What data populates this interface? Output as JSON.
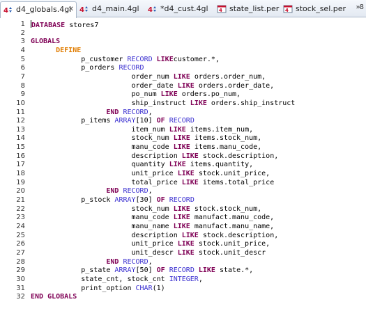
{
  "tabs": [
    {
      "label": "d4_globals.4gl",
      "active": true,
      "icon": "4gl-file-icon",
      "close": "✕"
    },
    {
      "label": "d4_main.4gl",
      "active": false,
      "icon": "4gl-file-icon"
    },
    {
      "label": "*d4_cust.4gl",
      "active": false,
      "icon": "4gl-file-icon"
    },
    {
      "label": "state_list.per",
      "active": false,
      "icon": "form-file-icon"
    },
    {
      "label": "stock_sel.per",
      "active": false,
      "icon": "form-file-icon"
    }
  ],
  "overflow_label": "»8",
  "lines": [
    {
      "n": "1",
      "tokens": [
        [
          "kw",
          "DATABASE"
        ],
        [
          "",
          "stores7"
        ]
      ]
    },
    {
      "n": "2",
      "tokens": []
    },
    {
      "n": "3",
      "tokens": [
        [
          "kw",
          "GLOBALS"
        ]
      ]
    },
    {
      "n": "4",
      "tokens": [
        [
          "",
          "      "
        ],
        [
          "kw2",
          "DEFINE"
        ]
      ]
    },
    {
      "n": "5",
      "tokens": [
        [
          "",
          "            p_customer "
        ],
        [
          "ty",
          "RECORD"
        ],
        [
          "",
          ""
        ],
        [
          "kw",
          " LIKE"
        ],
        [
          "",
          ""
        ],
        [
          "",
          "customer.*,"
        ]
      ]
    },
    {
      "n": "6",
      "tokens": [
        [
          "",
          "            p_orders "
        ],
        [
          "ty",
          "RECORD"
        ]
      ]
    },
    {
      "n": "7",
      "tokens": [
        [
          "",
          "                        order_num "
        ],
        [
          "kw",
          "LIKE"
        ],
        [
          "",
          " orders.order_num,"
        ]
      ]
    },
    {
      "n": "8",
      "tokens": [
        [
          "",
          "                        order_date "
        ],
        [
          "kw",
          "LIKE"
        ],
        [
          "",
          " orders.order_date,"
        ]
      ]
    },
    {
      "n": "9",
      "tokens": [
        [
          "",
          "                        po_num "
        ],
        [
          "kw",
          "LIKE"
        ],
        [
          "",
          " orders.po_num,"
        ]
      ]
    },
    {
      "n": "10",
      "tokens": [
        [
          "",
          "                        ship_instruct "
        ],
        [
          "kw",
          "LIKE"
        ],
        [
          "",
          " orders.ship_instruct"
        ]
      ]
    },
    {
      "n": "11",
      "tokens": [
        [
          "",
          "                  "
        ],
        [
          "kw",
          "END"
        ],
        [
          "",
          " "
        ],
        [
          "ty",
          "RECORD"
        ],
        [
          "",
          ","
        ]
      ]
    },
    {
      "n": "12",
      "tokens": [
        [
          "",
          "            p_items "
        ],
        [
          "ty",
          "ARRAY"
        ],
        [
          "",
          "[10] "
        ],
        [
          "kw",
          "OF"
        ],
        [
          "",
          " "
        ],
        [
          "ty",
          "RECORD"
        ]
      ]
    },
    {
      "n": "13",
      "tokens": [
        [
          "",
          "                        item_num "
        ],
        [
          "kw",
          "LIKE"
        ],
        [
          "",
          " items.item_num,"
        ]
      ]
    },
    {
      "n": "14",
      "tokens": [
        [
          "",
          "                        stock_num "
        ],
        [
          "kw",
          "LIKE"
        ],
        [
          "",
          " items.stock_num,"
        ]
      ]
    },
    {
      "n": "15",
      "tokens": [
        [
          "",
          "                        manu_code "
        ],
        [
          "kw",
          "LIKE"
        ],
        [
          "",
          " items.manu_code,"
        ]
      ]
    },
    {
      "n": "16",
      "tokens": [
        [
          "",
          "                        description "
        ],
        [
          "kw",
          "LIKE"
        ],
        [
          "",
          " stock.description,"
        ]
      ]
    },
    {
      "n": "17",
      "tokens": [
        [
          "",
          "                        quantity "
        ],
        [
          "kw",
          "LIKE"
        ],
        [
          "",
          " items.quantity,"
        ]
      ]
    },
    {
      "n": "18",
      "tokens": [
        [
          "",
          "                        unit_price "
        ],
        [
          "kw",
          "LIKE"
        ],
        [
          "",
          " stock.unit_price,"
        ]
      ]
    },
    {
      "n": "19",
      "tokens": [
        [
          "",
          "                        total_price "
        ],
        [
          "kw",
          "LIKE"
        ],
        [
          "",
          " items.total_price"
        ]
      ]
    },
    {
      "n": "20",
      "tokens": [
        [
          "",
          "                  "
        ],
        [
          "kw",
          "END"
        ],
        [
          "",
          " "
        ],
        [
          "ty",
          "RECORD"
        ],
        [
          "",
          ","
        ]
      ]
    },
    {
      "n": "21",
      "tokens": [
        [
          "",
          "            p_stock "
        ],
        [
          "ty",
          "ARRAY"
        ],
        [
          "",
          "[30] "
        ],
        [
          "kw",
          "OF"
        ],
        [
          "",
          " "
        ],
        [
          "ty",
          "RECORD"
        ]
      ]
    },
    {
      "n": "22",
      "tokens": [
        [
          "",
          "                        stock_num "
        ],
        [
          "kw",
          "LIKE"
        ],
        [
          "",
          " stock.stock_num,"
        ]
      ]
    },
    {
      "n": "23",
      "tokens": [
        [
          "",
          "                        manu_code "
        ],
        [
          "kw",
          "LIKE"
        ],
        [
          "",
          " manufact.manu_code,"
        ]
      ]
    },
    {
      "n": "24",
      "tokens": [
        [
          "",
          "                        manu_name "
        ],
        [
          "kw",
          "LIKE"
        ],
        [
          "",
          " manufact.manu_name,"
        ]
      ]
    },
    {
      "n": "25",
      "tokens": [
        [
          "",
          "                        description "
        ],
        [
          "kw",
          "LIKE"
        ],
        [
          "",
          " stock.description,"
        ]
      ]
    },
    {
      "n": "26",
      "tokens": [
        [
          "",
          "                        unit_price "
        ],
        [
          "kw",
          "LIKE"
        ],
        [
          "",
          " stock.unit_price,"
        ]
      ]
    },
    {
      "n": "27",
      "tokens": [
        [
          "",
          "                        unit_descr "
        ],
        [
          "kw",
          "LIKE"
        ],
        [
          "",
          " stock.unit_descr"
        ]
      ]
    },
    {
      "n": "28",
      "tokens": [
        [
          "",
          "                  "
        ],
        [
          "kw",
          "END"
        ],
        [
          "",
          " "
        ],
        [
          "ty",
          "RECORD"
        ],
        [
          "",
          ","
        ]
      ]
    },
    {
      "n": "29",
      "tokens": [
        [
          "",
          "            p_state "
        ],
        [
          "ty",
          "ARRAY"
        ],
        [
          "",
          "[50] "
        ],
        [
          "kw",
          "OF"
        ],
        [
          "",
          " "
        ],
        [
          "ty",
          "RECORD"
        ],
        [
          "",
          " "
        ],
        [
          "kw",
          "LIKE"
        ],
        [
          "",
          " state.*,"
        ]
      ]
    },
    {
      "n": "30",
      "tokens": [
        [
          "",
          "            state_cnt, stock_cnt "
        ],
        [
          "ty",
          "INTEGER"
        ],
        [
          "",
          ","
        ]
      ]
    },
    {
      "n": "31",
      "tokens": [
        [
          "",
          "            print_option "
        ],
        [
          "ty",
          "CHAR"
        ],
        [
          "",
          "(1)"
        ]
      ]
    },
    {
      "n": "32",
      "tokens": [
        [
          "kw",
          "END"
        ],
        [
          "",
          " "
        ],
        [
          "kw",
          "GLOBALS"
        ]
      ]
    }
  ]
}
